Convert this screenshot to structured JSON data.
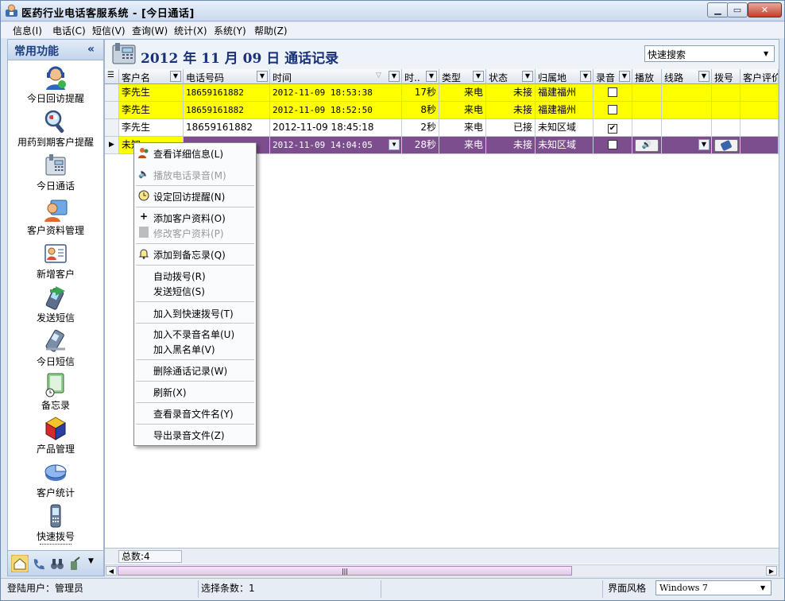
{
  "window": {
    "title": "医药行业电话客服系统 - [今日通话]"
  },
  "menubar": [
    "信息(I)",
    "电话(C)",
    "短信(V)",
    "查询(W)",
    "统计(X)",
    "系统(Y)",
    "帮助(Z)"
  ],
  "sidebar": {
    "title": "常用功能",
    "collapse_icon": "«",
    "items": [
      {
        "label": "今日回访提醒",
        "icon": "headset-person-icon"
      },
      {
        "label": "用药到期客户提醒",
        "icon": "magnifier-pills-icon"
      },
      {
        "label": "今日通话",
        "icon": "phone-icon"
      },
      {
        "label": "客户资料管理",
        "icon": "customer-card-icon"
      },
      {
        "label": "新增客户",
        "icon": "add-customer-icon"
      },
      {
        "label": "发送短信",
        "icon": "send-sms-icon"
      },
      {
        "label": "今日短信",
        "icon": "sms-phone-icon"
      },
      {
        "label": "备忘录",
        "icon": "memo-clock-icon"
      },
      {
        "label": "产品管理",
        "icon": "product-cubes-icon"
      },
      {
        "label": "客户统计",
        "icon": "pie-chart-icon"
      },
      {
        "label": "快速拨号",
        "icon": "mobile-phone-icon"
      }
    ]
  },
  "header": {
    "title": "2012 年 11 月 09 日 通话记录",
    "quick_search": "快速搜索"
  },
  "table": {
    "columns": [
      "客户名",
      "电话号码",
      "时间",
      "时..",
      "类型",
      "状态",
      "归属地",
      "录音",
      "播放",
      "线路",
      "拨号",
      "客户评价"
    ],
    "rows": [
      {
        "name": "李先生",
        "phone": "18659161882",
        "time": "2012-11-09 18:53:38",
        "duration": "17秒",
        "type": "来电",
        "status": "未接",
        "location": "福建福州",
        "recorded": false,
        "highlight": "yellow"
      },
      {
        "name": "李先生",
        "phone": "18659161882",
        "time": "2012-11-09 18:52:50",
        "duration": "8秒",
        "type": "来电",
        "status": "未接",
        "location": "福建福州",
        "recorded": false,
        "highlight": "yellow"
      },
      {
        "name": "李先生",
        "phone": "18659161882",
        "time": "2012-11-09 18:45:18",
        "duration": "2秒",
        "type": "来电",
        "status": "已接",
        "location": "未知区域",
        "recorded": true,
        "highlight": "none"
      },
      {
        "name": "未知",
        "phone": "",
        "time": "2012-11-09 14:04:05",
        "duration": "28秒",
        "type": "来电",
        "status": "未接",
        "location": "未知区域",
        "recorded": false,
        "highlight": "selected"
      }
    ],
    "total": "总数:4"
  },
  "context_menu": [
    {
      "label": "查看详细信息(L)",
      "icon": "users-icon",
      "disabled": false
    },
    {
      "label": "播放电话录音(M)",
      "icon": "speaker-icon",
      "disabled": true
    },
    {
      "label": "设定回访提醒(N)",
      "icon": "clock-icon",
      "disabled": false
    },
    {
      "label": "添加客户资料(O)",
      "icon": "plus-icon",
      "disabled": false
    },
    {
      "label": "修改客户资料(P)",
      "icon": "document-icon",
      "disabled": true
    },
    {
      "label": "添加到备忘录(Q)",
      "icon": "bell-icon",
      "disabled": false
    },
    {
      "label": "自动拨号(R)",
      "disabled": false
    },
    {
      "label": "发送短信(S)",
      "disabled": false
    },
    {
      "label": "加入到快速拨号(T)",
      "disabled": false
    },
    {
      "label": "加入不录音名单(U)",
      "disabled": false
    },
    {
      "label": "加入黑名单(V)",
      "disabled": false
    },
    {
      "label": "删除通话记录(W)",
      "disabled": false
    },
    {
      "label": "刷新(X)",
      "disabled": false
    },
    {
      "label": "查看录音文件名(Y)",
      "disabled": false
    },
    {
      "label": "导出录音文件(Z)",
      "disabled": false
    }
  ],
  "statusbar": {
    "user": "登陆用户：管理员",
    "selected": "选择条数：1",
    "style_label": "界面风格",
    "style_value": "Windows 7"
  },
  "colors": {
    "row_highlight": "#ffff00",
    "row_selected": "#7c4e8e",
    "title_blue": "#17317a",
    "accent_blue": "#1c3f82"
  }
}
